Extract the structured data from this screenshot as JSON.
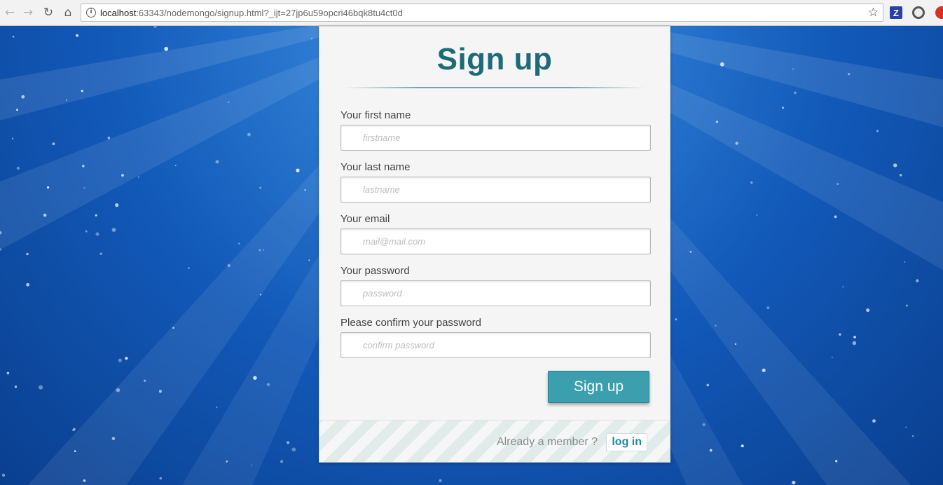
{
  "browser": {
    "url_host": "localhost",
    "url_rest": ":63343/nodemongo/signup.html?_ijt=27jp6u59opcri46bqk8tu4ct0d",
    "back_glyph": "←",
    "forward_glyph": "→",
    "reload_glyph": "↻",
    "home_glyph": "⌂",
    "info_glyph": "i",
    "star_glyph": "☆",
    "extension_z_label": "Z",
    "icons": [
      "back-arrow-icon",
      "forward-arrow-icon",
      "reload-icon",
      "home-icon",
      "info-icon",
      "star-icon",
      "z-extension-icon",
      "gear-extension-icon",
      "red-extension-icon"
    ]
  },
  "form": {
    "title": "Sign up",
    "fields": [
      {
        "label": "Your first name",
        "placeholder": "firstname"
      },
      {
        "label": "Your last name",
        "placeholder": "lastname"
      },
      {
        "label": "Your email",
        "placeholder": "mail@mail.com"
      },
      {
        "label": "Your password",
        "placeholder": "password"
      },
      {
        "label": "Please confirm your password",
        "placeholder": "confirm password"
      }
    ],
    "submit_label": "Sign up"
  },
  "footer": {
    "member_text": "Already a member ?",
    "login_label": "log in"
  },
  "colors": {
    "accent": "#3c9fae",
    "title": "#1d6a78",
    "link": "#1d8ba3",
    "background": "#1259b8"
  }
}
